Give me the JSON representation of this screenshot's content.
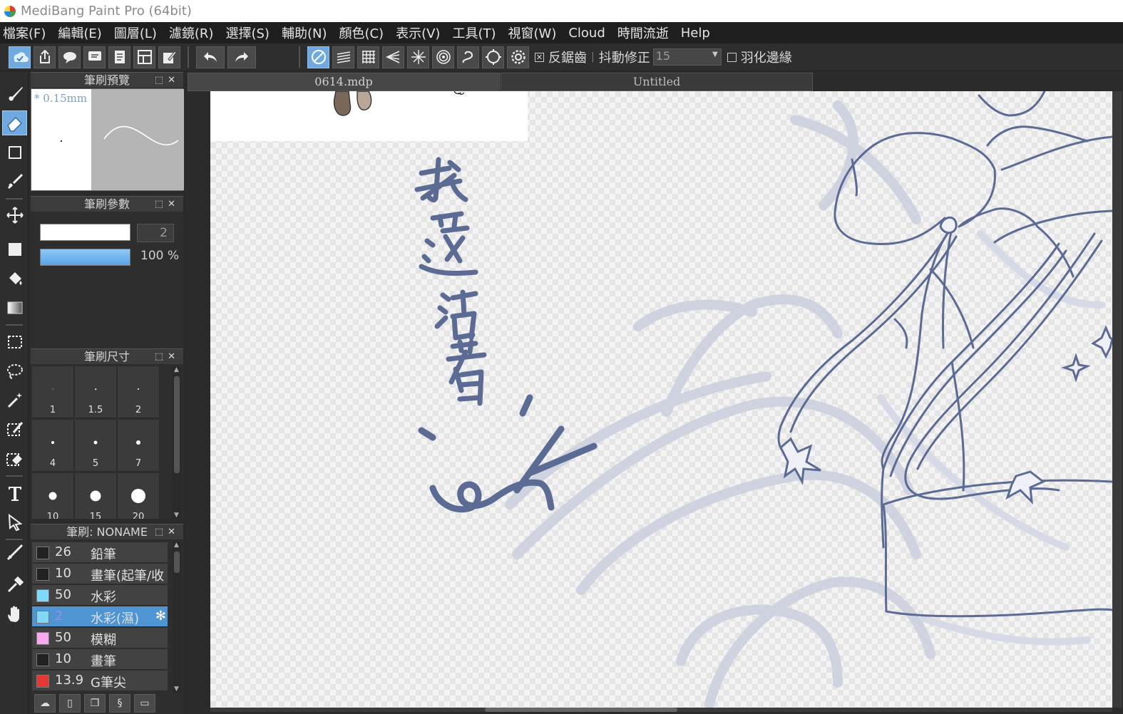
{
  "window": {
    "title": "MediBang Paint Pro (64bit)"
  },
  "menu": [
    "檔案(F)",
    "編輯(E)",
    "圖層(L)",
    "濾鏡(R)",
    "選擇(S)",
    "輔助(N)",
    "顏色(C)",
    "表示(V)",
    "工具(T)",
    "視窗(W)",
    "Cloud",
    "時間流逝",
    "Help"
  ],
  "toolbar": {
    "antialias_label": "反鋸齒",
    "stabilizer_label": "抖動修正",
    "stabilizer_value": "15",
    "feather_label": "羽化邊緣",
    "antialias_checked": true,
    "feather_checked": false
  },
  "panels": {
    "preview": {
      "title": "筆刷預覽",
      "size_label": "* 0.15mm"
    },
    "params": {
      "title": "筆刷參數",
      "width_value": "2",
      "opacity_value": "100 %"
    },
    "sizes": {
      "title": "筆刷尺寸",
      "cells": [
        {
          "label": "1",
          "dot": 1
        },
        {
          "label": "1.5",
          "dot": 1.5
        },
        {
          "label": "2",
          "dot": 2
        },
        {
          "label": "4",
          "dot": 4
        },
        {
          "label": "5",
          "dot": 5
        },
        {
          "label": "7",
          "dot": 6
        },
        {
          "label": "10",
          "dot": 11
        },
        {
          "label": "15",
          "dot": 15
        },
        {
          "label": "20",
          "dot": 20
        }
      ]
    },
    "brushes": {
      "title": "筆刷: NONAME",
      "items": [
        {
          "value": "26",
          "name": "鉛筆",
          "color": "#222222",
          "selected": false
        },
        {
          "value": "10",
          "name": "畫筆(起筆/收",
          "color": "#222222",
          "selected": false
        },
        {
          "value": "50",
          "name": "水彩",
          "color": "#7fd8f6",
          "selected": false
        },
        {
          "value": "2",
          "name": "水彩(濕)",
          "color": "#7fd8f6",
          "selected": true
        },
        {
          "value": "50",
          "name": "模糊",
          "color": "#f7a8f0",
          "selected": false
        },
        {
          "value": "10",
          "name": "畫筆",
          "color": "#222222",
          "selected": false
        },
        {
          "value": "13.9",
          "name": "G筆尖",
          "color": "#e53935",
          "selected": false
        }
      ]
    }
  },
  "documents": {
    "tabs": [
      {
        "label": "0614.mdp",
        "active": true
      },
      {
        "label": "Untitled",
        "active": false
      }
    ]
  },
  "colors": {
    "accent": "#6fa9e0",
    "stroke": "#5b6b93",
    "sketch": "#c3cadb"
  }
}
